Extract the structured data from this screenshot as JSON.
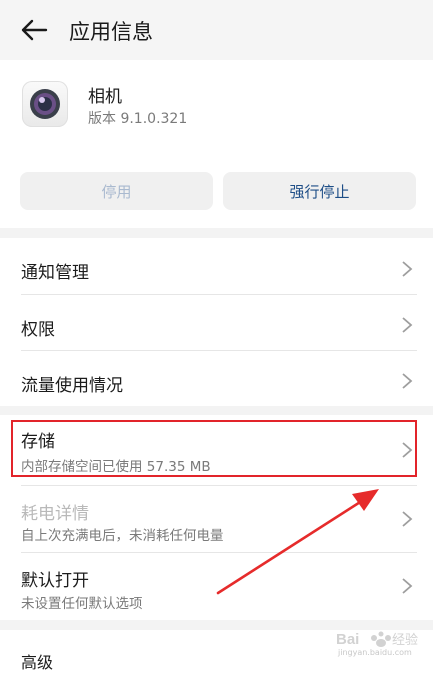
{
  "header": {
    "title": "应用信息",
    "back_icon": "arrow-left-icon"
  },
  "app": {
    "name": "相机",
    "version": "版本 9.1.0.321",
    "icon": "camera-app-icon"
  },
  "actions": {
    "disable_label": "停用",
    "force_stop_label": "强行停止"
  },
  "group1": [
    {
      "label": "通知管理"
    },
    {
      "label": "权限"
    },
    {
      "label": "流量使用情况"
    }
  ],
  "group2": [
    {
      "label": "存储",
      "sub": "内部存储空间已使用 57.35 MB"
    },
    {
      "label": "耗电详情",
      "sub": "自上次充满电后，未消耗任何电量"
    },
    {
      "label": "默认打开",
      "sub": "未设置任何默认选项"
    }
  ],
  "group3": [
    {
      "label": "高级"
    }
  ],
  "annotation": {
    "highlight_color": "#e2242a"
  },
  "watermark": {
    "url": "jingyan.baidu.com"
  }
}
